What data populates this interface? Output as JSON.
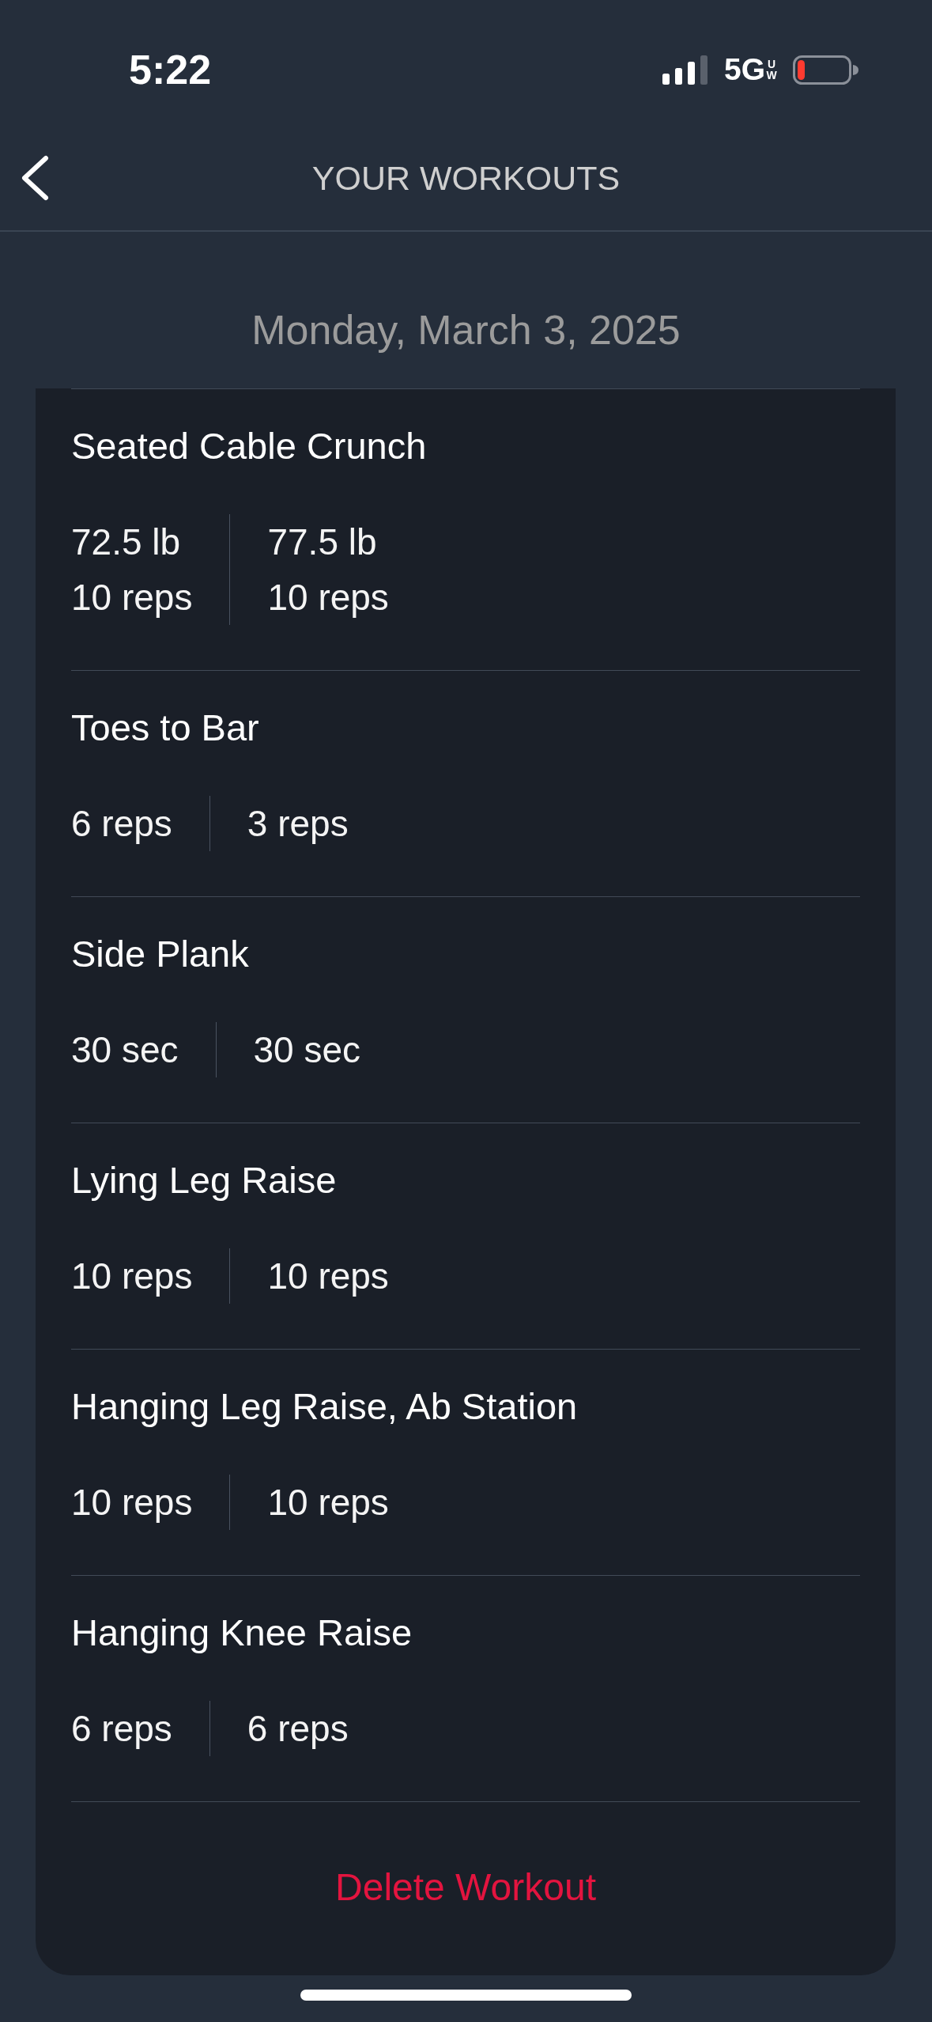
{
  "status_bar": {
    "time": "5:22",
    "network": "5G",
    "network_suffix": "UW"
  },
  "header": {
    "title": "YOUR WORKOUTS"
  },
  "date": "Monday, March 3, 2025",
  "exercises": [
    {
      "name": "Seated Cable Crunch",
      "sets": [
        {
          "weight": "72.5 lb",
          "reps": "10 reps"
        },
        {
          "weight": "77.5 lb",
          "reps": "10 reps"
        }
      ]
    },
    {
      "name": "Toes to Bar",
      "sets": [
        {
          "reps": "6 reps"
        },
        {
          "reps": "3 reps"
        }
      ]
    },
    {
      "name": "Side Plank",
      "sets": [
        {
          "duration": "30 sec"
        },
        {
          "duration": "30 sec"
        }
      ]
    },
    {
      "name": "Lying Leg Raise",
      "sets": [
        {
          "reps": "10 reps"
        },
        {
          "reps": "10 reps"
        }
      ]
    },
    {
      "name": "Hanging Leg Raise, Ab Station",
      "sets": [
        {
          "reps": "10 reps"
        },
        {
          "reps": "10 reps"
        }
      ]
    },
    {
      "name": "Hanging Knee Raise",
      "sets": [
        {
          "reps": "6 reps"
        },
        {
          "reps": "6 reps"
        }
      ]
    }
  ],
  "delete_button": "Delete Workout"
}
